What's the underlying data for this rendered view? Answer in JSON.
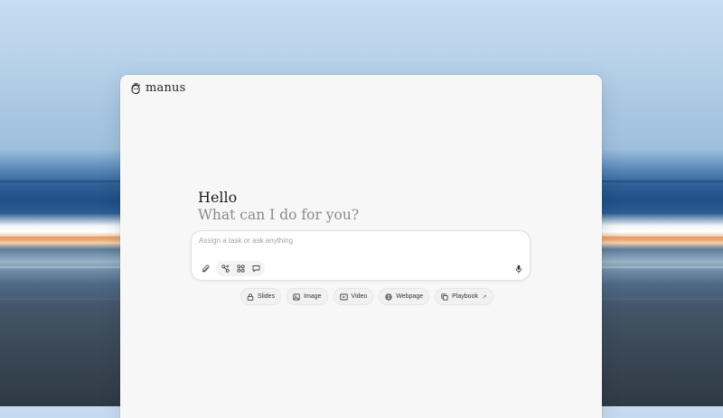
{
  "app": {
    "name": "manus"
  },
  "hero": {
    "greeting": "Hello",
    "subtitle": "What can I do for you?"
  },
  "composer": {
    "placeholder": "Assign a task or ask anything",
    "value": ""
  },
  "icons": {
    "logo": "manus-hand-logo-icon",
    "attach": "paperclip-icon",
    "tools": [
      "connectors-icon",
      "apps-grid-icon",
      "chat-bubble-icon"
    ],
    "mic": "microphone-icon"
  },
  "quick_actions": [
    {
      "label": "Slides",
      "icon": "lock-icon"
    },
    {
      "label": "Image",
      "icon": "image-icon"
    },
    {
      "label": "Video",
      "icon": "video-icon"
    },
    {
      "label": "Webpage",
      "icon": "globe-icon"
    },
    {
      "label": "Playbook",
      "icon": "copy-icon",
      "suffix": "↗"
    }
  ]
}
